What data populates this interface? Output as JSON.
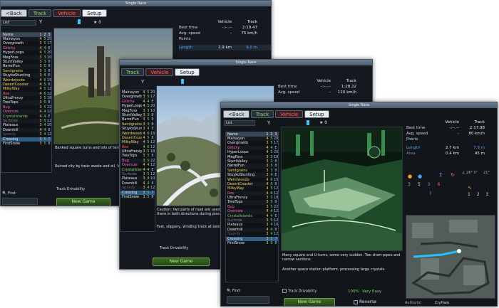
{
  "window_title": "Single Race",
  "tabs": {
    "back": "<Back",
    "track": "Track",
    "vehicle": "Vehicle",
    "setup": "Setup"
  },
  "list_mode": "List",
  "fav_count": "0",
  "list_headers": [
    "Name",
    "1",
    "2",
    "3"
  ],
  "tracks": [
    {
      "name": "Mainayon",
      "a": "4",
      "b": "5",
      "c": "20",
      "color": "#e8e8e8"
    },
    {
      "name": "Overgrowth",
      "a": "3",
      "b": "5",
      "c": "17",
      "color": "#e8e8e8"
    },
    {
      "name": "Glitchy",
      "a": "4",
      "b": "4",
      "c": "E",
      "color": "#ff5fb8"
    },
    {
      "name": "HyperLoops",
      "a": "4",
      "b": "5",
      "c": "20",
      "color": "#e8e8e8"
    },
    {
      "name": "MegFoss",
      "a": "3",
      "b": "3",
      "c": "10",
      "color": "#e8e8e8"
    },
    {
      "name": "StuntValley",
      "a": "3",
      "b": "3",
      "c": "8",
      "color": "#e8e8e8"
    },
    {
      "name": "BarrelFun",
      "a": "3",
      "b": "5",
      "c": "8",
      "color": "#e8e8e8"
    },
    {
      "name": "Sandgrains",
      "a": "3",
      "b": "3",
      "c": "8",
      "color": "#f3d05a"
    },
    {
      "name": "StuykoStunting",
      "a": "3",
      "b": "4",
      "c": "E",
      "color": "#e8e8e8"
    },
    {
      "name": "Weirdwoodo",
      "a": "4",
      "b": "6",
      "c": "15",
      "color": "#f3d05a"
    },
    {
      "name": "DesertCoaster",
      "a": "4",
      "b": "5",
      "c": "8",
      "color": "#f3d05a"
    },
    {
      "name": "MilkyWay",
      "a": "4",
      "b": "5",
      "c": "12",
      "color": "#f3d05a"
    },
    {
      "name": "Roe",
      "a": "4",
      "b": "6",
      "c": "12",
      "color": "#ff5a5a"
    },
    {
      "name": "UltraFrenzy",
      "a": "3",
      "b": "5",
      "c": "18",
      "color": "#e8e8e8"
    },
    {
      "name": "TreeTops",
      "a": "3",
      "b": "5",
      "c": "8",
      "color": "#e8e8e8"
    },
    {
      "name": "Bug",
      "a": "3",
      "b": "5",
      "c": "22",
      "color": "#ff5fb8"
    },
    {
      "name": "Oversize",
      "a": "4",
      "b": "4",
      "c": "12",
      "color": "#ff5fb8"
    },
    {
      "name": "Crystallslands",
      "a": "4",
      "b": "4",
      "c": "E",
      "color": "#7fd06a"
    },
    {
      "name": "Surfoide",
      "a": "3",
      "b": "5",
      "c": "12",
      "color": "#8b6b8b"
    },
    {
      "name": "Plateaus",
      "a": "3",
      "b": "4",
      "c": "10",
      "color": "#e8e8e8"
    },
    {
      "name": "Downhill",
      "a": "4",
      "b": "4",
      "c": "8",
      "color": "#e8e8e8"
    },
    {
      "name": "Speedy",
      "a": "3",
      "b": "4",
      "c": "12",
      "color": "#6a5670"
    },
    {
      "name": "Crossing",
      "a": "3",
      "b": "5",
      "c": "7",
      "color": "#e8e8e8"
    },
    {
      "name": "FirstSnow",
      "a": "3",
      "b": "5",
      "c": "8",
      "color": "#e8e8e8"
    }
  ],
  "stats": {
    "col_vehicle": "Vehicle",
    "col_track": "Track",
    "best_time_label": "Best time",
    "avg_speed_label": "Avg. speed",
    "points_label": "Points",
    "length_label": "Length",
    "area_label": "Area",
    "back_best": "2:19.47",
    "back_avg": "75 km/h",
    "back_len": "2.9 km",
    "back_len2": "9.0 m",
    "mid_best": "1:28.22",
    "mid_avg": "110 km/h",
    "front_best": "2:17.98",
    "front_avg": "80 km/h",
    "front_len": "2.7 km",
    "front_len2": "7.9 m",
    "front_area": "0.4 km",
    "front_area2": "45 m",
    "empty_vehicle": "-:--.--",
    "empty_avg": "-",
    "front_nums": [
      "3",
      "5",
      "3",
      "6",
      "1",
      "2",
      "3"
    ],
    "front_deg": [
      "26",
      "3",
      "21"
    ]
  },
  "descriptions": {
    "back": "Banked square turns and lots of terrain. Ice half pipe passes.",
    "back2": "Ruined city by toxic waste and oil. Very",
    "mid": "Caution: two parts of road are used to drive there in both directions during places.",
    "mid2": "Fast, slippery, winding track at eeduring snow.",
    "front": "Many square and U-turns, some very sudden. Two short pipes and narrow sections.",
    "front2": "Another space station platform, processing large crystals."
  },
  "find_label": "Find:",
  "drivability_label": "Track Drivability",
  "drivability_value": "100%",
  "drivability_text": "Very Easy",
  "new_game": "New Game",
  "reverse_label": "Reverse",
  "author_label": "Author(s)",
  "author_name": "CryHam"
}
